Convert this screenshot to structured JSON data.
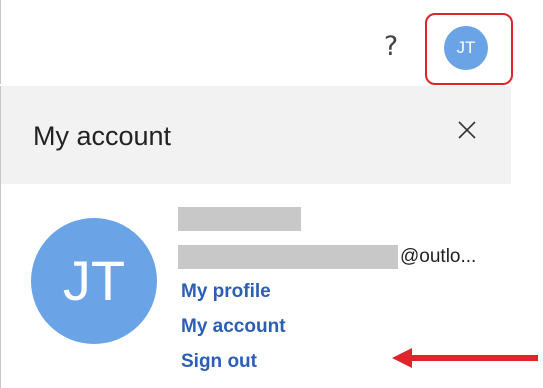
{
  "topbar": {
    "help_icon_glyph": "?",
    "avatar_initials": "JT",
    "highlight_color": "#e0242b"
  },
  "panel": {
    "title": "My account",
    "close_icon": "close-icon",
    "avatar_initials": "JT",
    "email_suffix": "@outlo...",
    "links": {
      "my_profile": "My profile",
      "my_account": "My account",
      "sign_out": "Sign out"
    }
  },
  "colors": {
    "avatar": "#6aa4e6",
    "link": "#2c5fb4",
    "header_bg": "#f2f2f2",
    "redaction": "#c8c8c8",
    "annotation": "#e0242b"
  }
}
